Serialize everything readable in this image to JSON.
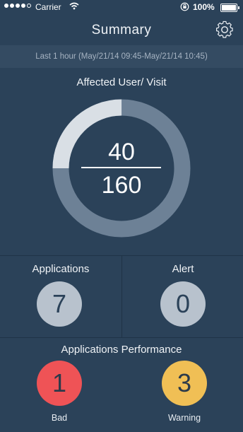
{
  "status_bar": {
    "carrier": "Carrier",
    "battery": "100%"
  },
  "nav": {
    "title": "Summary",
    "settings_icon": "gear-icon"
  },
  "time_range": "Last 1 hour  (May/21/14 09:45-May/21/14 10:45)",
  "affected": {
    "heading": "Affected User/ Visit",
    "affected_count": "40",
    "total_count": "160",
    "fraction": 0.25,
    "colors": {
      "affected": "#d9dfe5",
      "rest": "#6d8196"
    }
  },
  "stats": {
    "applications": {
      "label": "Applications",
      "value": "7"
    },
    "alert": {
      "label": "Alert",
      "value": "0"
    }
  },
  "performance": {
    "heading": "Applications Performance",
    "bad": {
      "label": "Bad",
      "value": "1",
      "color": "#ef5356"
    },
    "warning": {
      "label": "Warning",
      "value": "3",
      "color": "#f0bf55"
    }
  }
}
